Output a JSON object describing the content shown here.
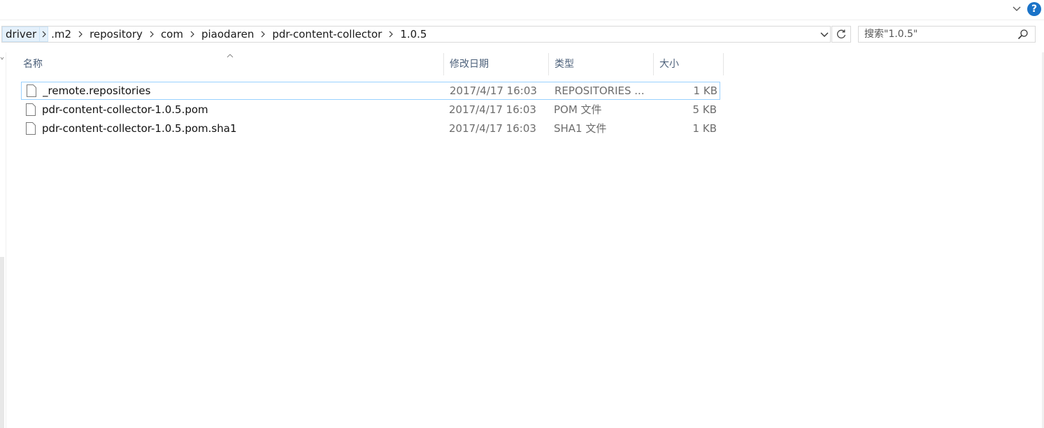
{
  "window": {
    "help_label": "?"
  },
  "address": {
    "crumbs": [
      "driver",
      ".m2",
      "repository",
      "com",
      "piaodaren",
      "pdr-content-collector",
      "1.0.5"
    ]
  },
  "search": {
    "placeholder": "搜索\"1.0.5\""
  },
  "columns": {
    "name": "名称",
    "date": "修改日期",
    "type": "类型",
    "size": "大小"
  },
  "files": [
    {
      "name": "_remote.repositories",
      "date": "2017/4/17 16:03",
      "type": "REPOSITORIES ...",
      "size": "1 KB",
      "selected": true
    },
    {
      "name": "pdr-content-collector-1.0.5.pom",
      "date": "2017/4/17 16:03",
      "type": "POM 文件",
      "size": "5 KB",
      "selected": false
    },
    {
      "name": "pdr-content-collector-1.0.5.pom.sha1",
      "date": "2017/4/17 16:03",
      "type": "SHA1 文件",
      "size": "1 KB",
      "selected": false
    }
  ],
  "icons": {
    "ribbon_toggle": "chevron-down-icon",
    "help": "help-icon",
    "breadcrumb_sep": "chevron-right-icon",
    "address_dropdown": "chevron-down-icon",
    "refresh": "refresh-icon",
    "search": "search-icon",
    "sort": "sort-ascending-icon",
    "file": "document-icon"
  },
  "colors": {
    "selection_border": "#99d1ff",
    "crumb_highlight": "#e5f1fb",
    "help_blue": "#1a73c8",
    "header_text": "#4c607a"
  }
}
